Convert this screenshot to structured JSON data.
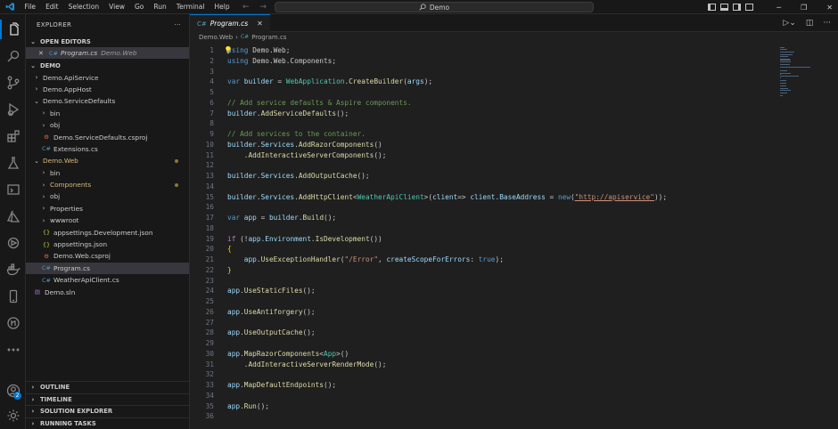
{
  "menu": [
    "File",
    "Edit",
    "Selection",
    "View",
    "Go",
    "Run",
    "Terminal",
    "Help"
  ],
  "command_center": {
    "text": "Demo"
  },
  "explorer": {
    "title": "EXPLORER",
    "more": "···",
    "open_editors": {
      "header": "OPEN EDITORS",
      "items": [
        {
          "name": "Program.cs",
          "desc": "Demo.Web"
        }
      ]
    },
    "workspace_header": "DEMO",
    "tree": [
      {
        "label": "Demo.ApiService",
        "indent": 0,
        "kind": "folder",
        "open": false
      },
      {
        "label": "Demo.AppHost",
        "indent": 0,
        "kind": "folder",
        "open": false
      },
      {
        "label": "Demo.ServiceDefaults",
        "indent": 0,
        "kind": "folder",
        "open": true
      },
      {
        "label": "bin",
        "indent": 1,
        "kind": "folder",
        "open": false
      },
      {
        "label": "obj",
        "indent": 1,
        "kind": "folder",
        "open": false
      },
      {
        "label": "Demo.ServiceDefaults.csproj",
        "indent": 1,
        "kind": "proj"
      },
      {
        "label": "Extensions.cs",
        "indent": 1,
        "kind": "cs"
      },
      {
        "label": "Demo.Web",
        "indent": 0,
        "kind": "folder",
        "open": true,
        "modified": true
      },
      {
        "label": "bin",
        "indent": 1,
        "kind": "folder",
        "open": false
      },
      {
        "label": "Components",
        "indent": 1,
        "kind": "folder",
        "open": false,
        "modified": true
      },
      {
        "label": "obj",
        "indent": 1,
        "kind": "folder",
        "open": false
      },
      {
        "label": "Properties",
        "indent": 1,
        "kind": "folder",
        "open": false
      },
      {
        "label": "wwwroot",
        "indent": 1,
        "kind": "folder",
        "open": false
      },
      {
        "label": "appsettings.Development.json",
        "indent": 1,
        "kind": "json"
      },
      {
        "label": "appsettings.json",
        "indent": 1,
        "kind": "json"
      },
      {
        "label": "Demo.Web.csproj",
        "indent": 1,
        "kind": "proj"
      },
      {
        "label": "Program.cs",
        "indent": 1,
        "kind": "cs",
        "selected": true
      },
      {
        "label": "WeatherApiClient.cs",
        "indent": 1,
        "kind": "cs"
      },
      {
        "label": "Demo.sln",
        "indent": 0,
        "kind": "sln"
      }
    ],
    "bottom_sections": [
      "OUTLINE",
      "TIMELINE",
      "SOLUTION EXPLORER",
      "RUNNING TASKS"
    ]
  },
  "accounts_badge": "2",
  "editor": {
    "tab": {
      "name": "Program.cs"
    },
    "breadcrumb": [
      "Demo.Web",
      "Program.cs"
    ],
    "lines": [
      [
        [
          "kw",
          "using"
        ],
        [
          "t",
          " "
        ],
        [
          "ns",
          "Demo.Web"
        ],
        [
          "t",
          ";"
        ]
      ],
      [
        [
          "kw",
          "using"
        ],
        [
          "t",
          " "
        ],
        [
          "ns",
          "Demo.Web.Components"
        ],
        [
          "t",
          ";"
        ]
      ],
      [],
      [
        [
          "kw",
          "var"
        ],
        [
          "t",
          " "
        ],
        [
          "var",
          "builder"
        ],
        [
          "t",
          " = "
        ],
        [
          "ty",
          "WebApplication"
        ],
        [
          "t",
          "."
        ],
        [
          "fn",
          "CreateBuilder"
        ],
        [
          "t",
          "("
        ],
        [
          "var",
          "args"
        ],
        [
          "t",
          ");"
        ]
      ],
      [],
      [
        [
          "cm",
          "// Add service defaults & Aspire components."
        ]
      ],
      [
        [
          "var",
          "builder"
        ],
        [
          "t",
          "."
        ],
        [
          "fn",
          "AddServiceDefaults"
        ],
        [
          "t",
          "();"
        ]
      ],
      [],
      [
        [
          "cm",
          "// Add services to the container."
        ]
      ],
      [
        [
          "var",
          "builder"
        ],
        [
          "t",
          "."
        ],
        [
          "pr",
          "Services"
        ],
        [
          "t",
          "."
        ],
        [
          "fn",
          "AddRazorComponents"
        ],
        [
          "t",
          "()"
        ]
      ],
      [
        [
          "t",
          "    ."
        ],
        [
          "fn",
          "AddInteractiveServerComponents"
        ],
        [
          "t",
          "();"
        ]
      ],
      [],
      [
        [
          "var",
          "builder"
        ],
        [
          "t",
          "."
        ],
        [
          "pr",
          "Services"
        ],
        [
          "t",
          "."
        ],
        [
          "fn",
          "AddOutputCache"
        ],
        [
          "t",
          "();"
        ]
      ],
      [],
      [
        [
          "var",
          "builder"
        ],
        [
          "t",
          "."
        ],
        [
          "pr",
          "Services"
        ],
        [
          "t",
          "."
        ],
        [
          "fn",
          "AddHttpClient"
        ],
        [
          "t",
          "<"
        ],
        [
          "ty",
          "WeatherApiClient"
        ],
        [
          "t",
          ">("
        ],
        [
          "var",
          "client"
        ],
        [
          "t",
          "=> "
        ],
        [
          "var",
          "client"
        ],
        [
          "t",
          "."
        ],
        [
          "pr",
          "BaseAddress"
        ],
        [
          "t",
          " = "
        ],
        [
          "kw",
          "new"
        ],
        [
          "t",
          "("
        ],
        [
          "str",
          "\"http://apiservice\""
        ],
        [
          "t",
          "));"
        ]
      ],
      [],
      [
        [
          "kw",
          "var"
        ],
        [
          "t",
          " "
        ],
        [
          "var",
          "app"
        ],
        [
          "t",
          " = "
        ],
        [
          "var",
          "builder"
        ],
        [
          "t",
          "."
        ],
        [
          "fn",
          "Build"
        ],
        [
          "t",
          "();"
        ]
      ],
      [],
      [
        [
          "ctl",
          "if"
        ],
        [
          "t",
          " (!"
        ],
        [
          "var",
          "app"
        ],
        [
          "t",
          "."
        ],
        [
          "pr",
          "Environment"
        ],
        [
          "t",
          "."
        ],
        [
          "fn",
          "IsDevelopment"
        ],
        [
          "t",
          "())"
        ]
      ],
      [
        [
          "br",
          "{"
        ]
      ],
      [
        [
          "t",
          "    "
        ],
        [
          "var",
          "app"
        ],
        [
          "t",
          "."
        ],
        [
          "fn",
          "UseExceptionHandler"
        ],
        [
          "t",
          "("
        ],
        [
          "str",
          "\"/Error\""
        ],
        [
          "t",
          ", "
        ],
        [
          "var",
          "createScopeForErrors"
        ],
        [
          "t",
          ": "
        ],
        [
          "kw",
          "true"
        ],
        [
          "t",
          ");"
        ]
      ],
      [
        [
          "br",
          "}"
        ]
      ],
      [],
      [
        [
          "var",
          "app"
        ],
        [
          "t",
          "."
        ],
        [
          "fn",
          "UseStaticFiles"
        ],
        [
          "t",
          "();"
        ]
      ],
      [],
      [
        [
          "var",
          "app"
        ],
        [
          "t",
          "."
        ],
        [
          "fn",
          "UseAntiforgery"
        ],
        [
          "t",
          "();"
        ]
      ],
      [],
      [
        [
          "var",
          "app"
        ],
        [
          "t",
          "."
        ],
        [
          "fn",
          "UseOutputCache"
        ],
        [
          "t",
          "();"
        ]
      ],
      [],
      [
        [
          "var",
          "app"
        ],
        [
          "t",
          "."
        ],
        [
          "fn",
          "MapRazorComponents"
        ],
        [
          "t",
          "<"
        ],
        [
          "ty",
          "App"
        ],
        [
          "t",
          ">()"
        ]
      ],
      [
        [
          "t",
          "    ."
        ],
        [
          "fn",
          "AddInteractiveServerRenderMode"
        ],
        [
          "t",
          "();"
        ]
      ],
      [],
      [
        [
          "var",
          "app"
        ],
        [
          "t",
          "."
        ],
        [
          "fn",
          "MapDefaultEndpoints"
        ],
        [
          "t",
          "();"
        ]
      ],
      [],
      [
        [
          "var",
          "app"
        ],
        [
          "t",
          "."
        ],
        [
          "fn",
          "Run"
        ],
        [
          "t",
          "();"
        ]
      ],
      []
    ]
  },
  "syntax_colors": {
    "kw": "#569cd6",
    "ctl": "#c586c0",
    "ns": "#cccccc",
    "var": "#9cdcfe",
    "ty": "#4ec9b0",
    "fn": "#dcdcaa",
    "pr": "#9cdcfe",
    "str": "#ce9178",
    "cm": "#6a9955",
    "t": "#cccccc",
    "br": "#ffd700"
  }
}
